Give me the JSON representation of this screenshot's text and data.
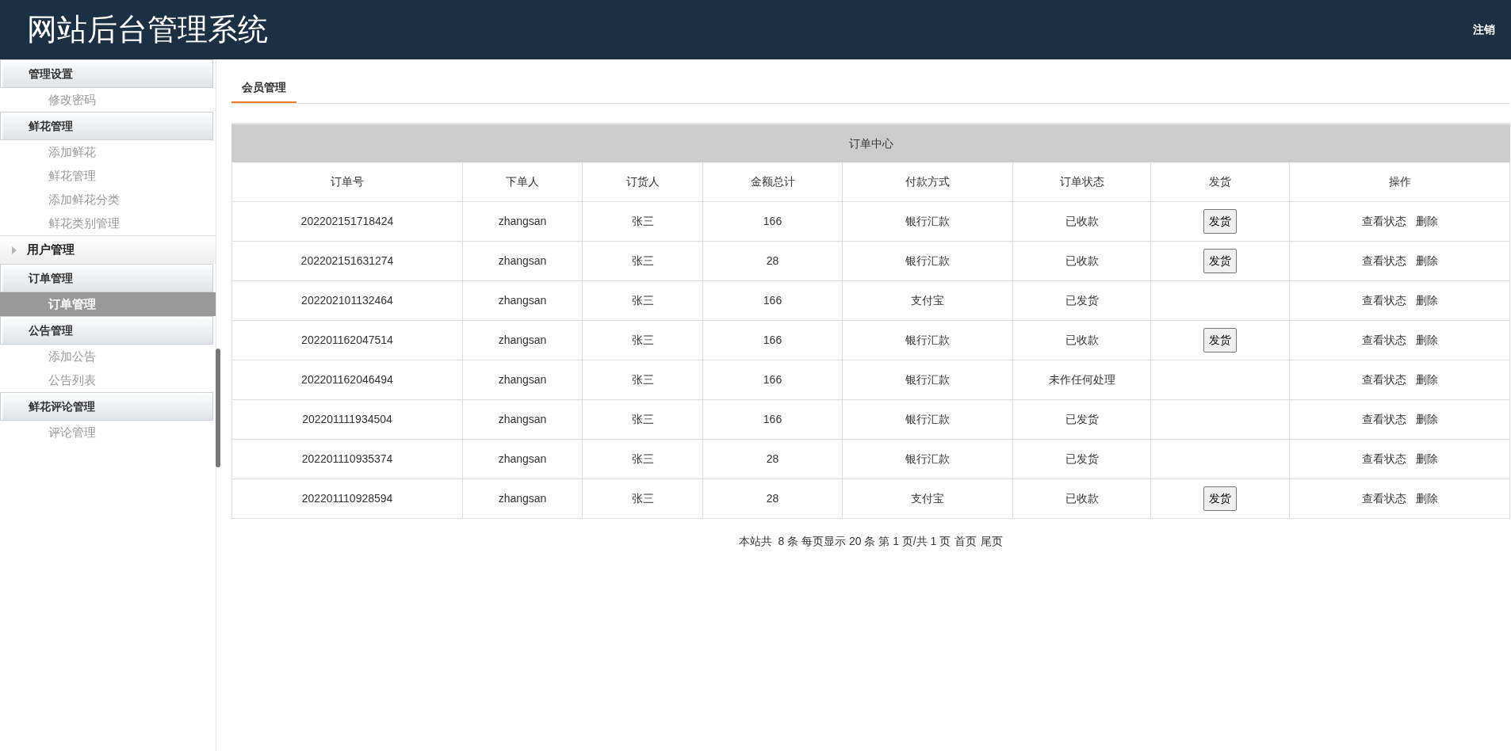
{
  "header": {
    "title": "网站后台管理系统",
    "logout": "注销"
  },
  "sidebar": [
    {
      "title": "管理设置",
      "expanded": true,
      "items": [
        {
          "label": "修改密码",
          "selected": false
        }
      ]
    },
    {
      "title": "鲜花管理",
      "expanded": true,
      "items": [
        {
          "label": "添加鲜花",
          "selected": false
        },
        {
          "label": "鲜花管理",
          "selected": false
        },
        {
          "label": "添加鲜花分类",
          "selected": false
        },
        {
          "label": "鲜花类别管理",
          "selected": false
        }
      ]
    },
    {
      "title": "用户管理",
      "expanded": false
    },
    {
      "title": "订单管理",
      "expanded": true,
      "items": [
        {
          "label": "订单管理",
          "selected": true
        }
      ]
    },
    {
      "title": "公告管理",
      "expanded": true,
      "items": [
        {
          "label": "添加公告",
          "selected": false
        },
        {
          "label": "公告列表",
          "selected": false
        }
      ]
    },
    {
      "title": "鲜花评论管理",
      "expanded": true,
      "items": [
        {
          "label": "评论管理",
          "selected": false
        }
      ]
    }
  ],
  "tabs": [
    {
      "label": "会员管理",
      "selected": true
    }
  ],
  "table": {
    "caption": "订单中心",
    "columns": [
      "订单号",
      "下单人",
      "订货人",
      "金额总计",
      "付款方式",
      "订单状态",
      "发货",
      "操作"
    ],
    "rows": [
      {
        "cells": [
          "202202151718424",
          "zhangsan",
          "张三",
          "166",
          "银行汇款",
          "已收款"
        ],
        "ship_button": "发货",
        "actions": [
          "查看状态",
          "删除"
        ]
      },
      {
        "cells": [
          "202202151631274",
          "zhangsan",
          "张三",
          "28",
          "银行汇款",
          "已收款"
        ],
        "ship_button": "发货",
        "actions": [
          "查看状态",
          "删除"
        ]
      },
      {
        "cells": [
          "202202101132464",
          "zhangsan",
          "张三",
          "166",
          "支付宝",
          "已发货"
        ],
        "actions": [
          "查看状态",
          "删除"
        ]
      },
      {
        "cells": [
          "202201162047514",
          "zhangsan",
          "张三",
          "166",
          "银行汇款",
          "已收款"
        ],
        "ship_button": "发货",
        "actions": [
          "查看状态",
          "删除"
        ]
      },
      {
        "cells": [
          "202201162046494",
          "zhangsan",
          "张三",
          "166",
          "银行汇款",
          "未作任何处理"
        ],
        "actions": [
          "查看状态",
          "删除"
        ]
      },
      {
        "cells": [
          "202201111934504",
          "zhangsan",
          "张三",
          "166",
          "银行汇款",
          "已发货"
        ],
        "actions": [
          "查看状态",
          "删除"
        ]
      },
      {
        "cells": [
          "202201110935374",
          "zhangsan",
          "张三",
          "28",
          "银行汇款",
          "已发货"
        ],
        "actions": [
          "查看状态",
          "删除"
        ]
      },
      {
        "cells": [
          "202201110928594",
          "zhangsan",
          "张三",
          "28",
          "支付宝",
          "已收款"
        ],
        "ship_button": "发货",
        "actions": [
          "查看状态",
          "删除"
        ]
      }
    ]
  },
  "pagination": {
    "summary": "本站共  8 条 每页显示 20 条 第 1 页/共 1 页",
    "links": [
      "首页",
      "尾页"
    ]
  }
}
